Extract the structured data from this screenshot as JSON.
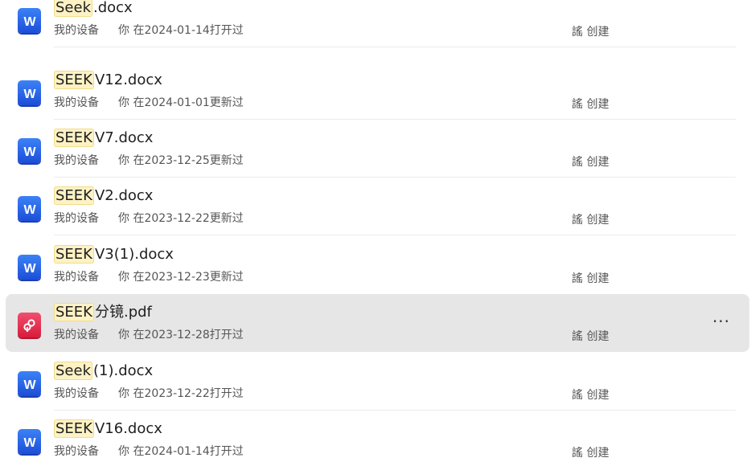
{
  "files": [
    {
      "highlight": "Seek",
      "rest": ".docx",
      "type": "word",
      "location": "我的设备",
      "activity": "你 在2024-01-14打开过",
      "creator": "謠 创建",
      "selected": false
    },
    {
      "highlight": "SEEK",
      "rest": "V12.docx",
      "type": "word",
      "location": "我的设备",
      "activity": "你 在2024-01-01更新过",
      "creator": "謠 创建",
      "selected": false
    },
    {
      "highlight": "SEEK",
      "rest": "V7.docx",
      "type": "word",
      "location": "我的设备",
      "activity": "你 在2023-12-25更新过",
      "creator": "謠 创建",
      "selected": false
    },
    {
      "highlight": "SEEK",
      "rest": "V2.docx",
      "type": "word",
      "location": "我的设备",
      "activity": "你 在2023-12-22更新过",
      "creator": "謠 创建",
      "selected": false
    },
    {
      "highlight": "SEEK",
      "rest": "V3(1).docx",
      "type": "word",
      "location": "我的设备",
      "activity": "你 在2023-12-23更新过",
      "creator": "謠 创建",
      "selected": false
    },
    {
      "highlight": "SEEK",
      "rest": "分镜.pdf",
      "type": "pdf",
      "location": "我的设备",
      "activity": "你 在2023-12-28打开过",
      "creator": "謠 创建",
      "selected": true
    },
    {
      "highlight": "Seek",
      "rest": "(1).docx",
      "type": "word",
      "location": "我的设备",
      "activity": "你 在2023-12-22打开过",
      "creator": "謠 创建",
      "selected": false
    },
    {
      "highlight": "SEEK",
      "rest": "V16.docx",
      "type": "word",
      "location": "我的设备",
      "activity": "你 在2024-01-14打开过",
      "creator": "謠 创建",
      "selected": false
    }
  ],
  "more_label": "···",
  "icon_names": {
    "word": "word-doc-icon",
    "pdf": "pdf-icon"
  },
  "colors": {
    "word": "#2563eb",
    "pdf": "#e11d48",
    "highlight": "#fdf2c4",
    "selected_row": "#e6e6e6"
  }
}
